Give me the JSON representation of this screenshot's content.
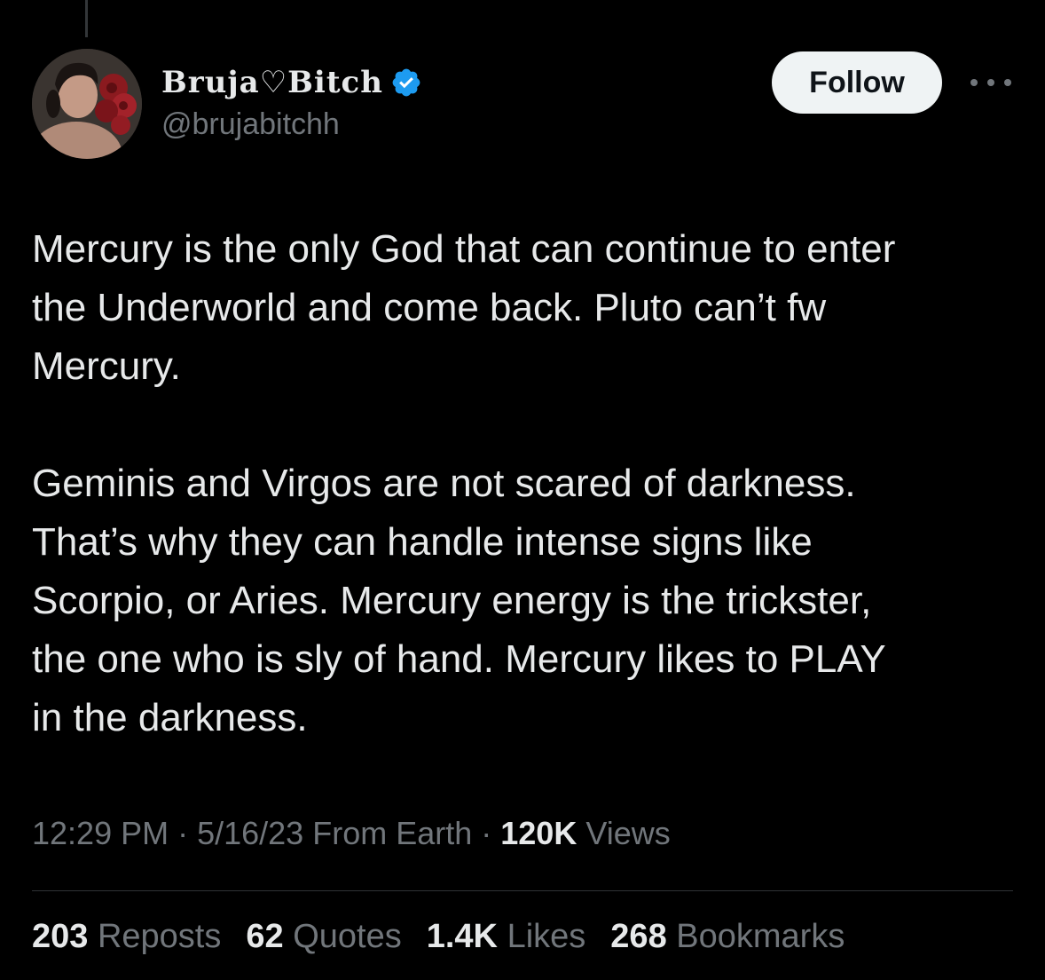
{
  "author": {
    "display_name": "Bruja♡Bitch",
    "handle": "@brujabitchh",
    "verified": true,
    "verified_color": "#1d9bf0"
  },
  "follow_label": "Follow",
  "tweet": {
    "paragraphs": [
      "Mercury is the only God that can continue to enter\nthe Underworld and come back. Pluto can’t fw\nMercury.",
      "Geminis and Virgos are not scared of darkness.\nThat’s why they can handle intense signs like\nScorpio, or Aries. Mercury energy is the trickster,\nthe one who is sly of hand. Mercury likes to PLAY\nin the darkness."
    ]
  },
  "meta": {
    "time": "12:29 PM",
    "sep1": " · ",
    "date": "5/16/23",
    "source": " From Earth",
    "sep2": " · ",
    "views_count": "120K",
    "views_label": " Views"
  },
  "stats": {
    "reposts": {
      "count": "203",
      "label": " Reposts"
    },
    "quotes": {
      "count": "62",
      "label": " Quotes"
    },
    "likes": {
      "count": "1.4K",
      "label": " Likes"
    },
    "bookmarks": {
      "count": "268",
      "label": " Bookmarks"
    }
  },
  "colors": {
    "background": "#000000",
    "text_primary": "#e7e9ea",
    "text_secondary": "#71767b",
    "divider": "#2f3336",
    "follow_bg": "#eff3f4"
  }
}
